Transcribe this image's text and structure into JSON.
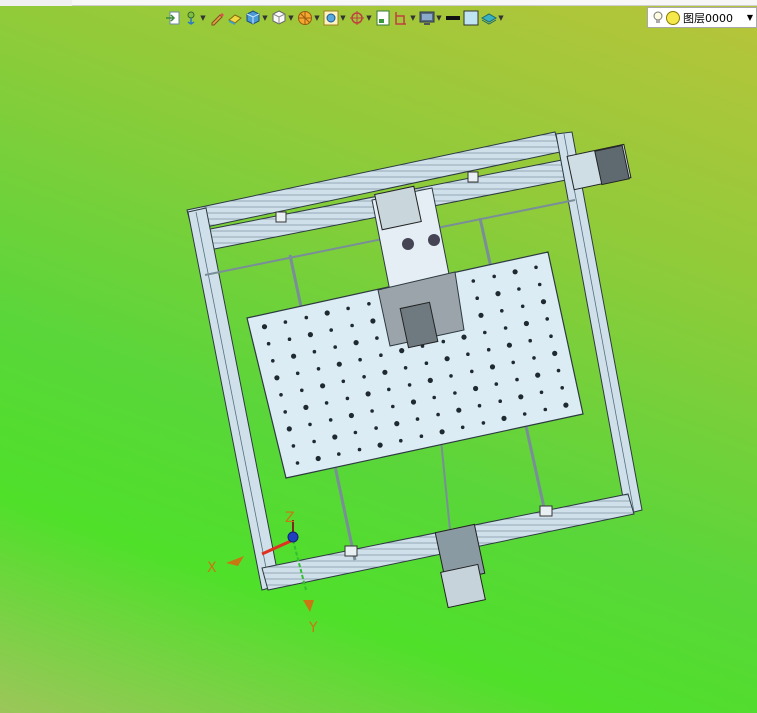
{
  "toolbar": {
    "icons": [
      {
        "name": "exit-sketch-icon",
        "has_dropdown": false
      },
      {
        "name": "snap-icon",
        "has_dropdown": true
      },
      {
        "name": "pencil-icon",
        "has_dropdown": false
      },
      {
        "name": "eraser-icon",
        "has_dropdown": false
      },
      {
        "name": "shaded-cube-icon",
        "has_dropdown": true
      },
      {
        "name": "wireframe-cube-icon",
        "has_dropdown": true
      },
      {
        "name": "section-view-icon",
        "has_dropdown": true
      },
      {
        "name": "zoom-fit-icon",
        "has_dropdown": true
      },
      {
        "name": "rotate-origin-icon",
        "has_dropdown": true
      },
      {
        "name": "sheet-icon",
        "has_dropdown": false
      },
      {
        "name": "dimension-icon",
        "has_dropdown": true
      },
      {
        "name": "display-icon",
        "has_dropdown": true
      },
      {
        "name": "line-color-icon",
        "has_dropdown": false
      },
      {
        "name": "fill-color-icon",
        "has_dropdown": false
      },
      {
        "name": "layer-stack-icon",
        "has_dropdown": true
      }
    ]
  },
  "layer": {
    "label": "图层0000"
  },
  "triad": {
    "x_label": "X",
    "y_label": "Y",
    "z_label": "Z"
  },
  "colors": {
    "frame": "#c8dbe6",
    "plate": "#dcecf5",
    "outline": "#2d3a40",
    "axis_label": "#c77812"
  }
}
